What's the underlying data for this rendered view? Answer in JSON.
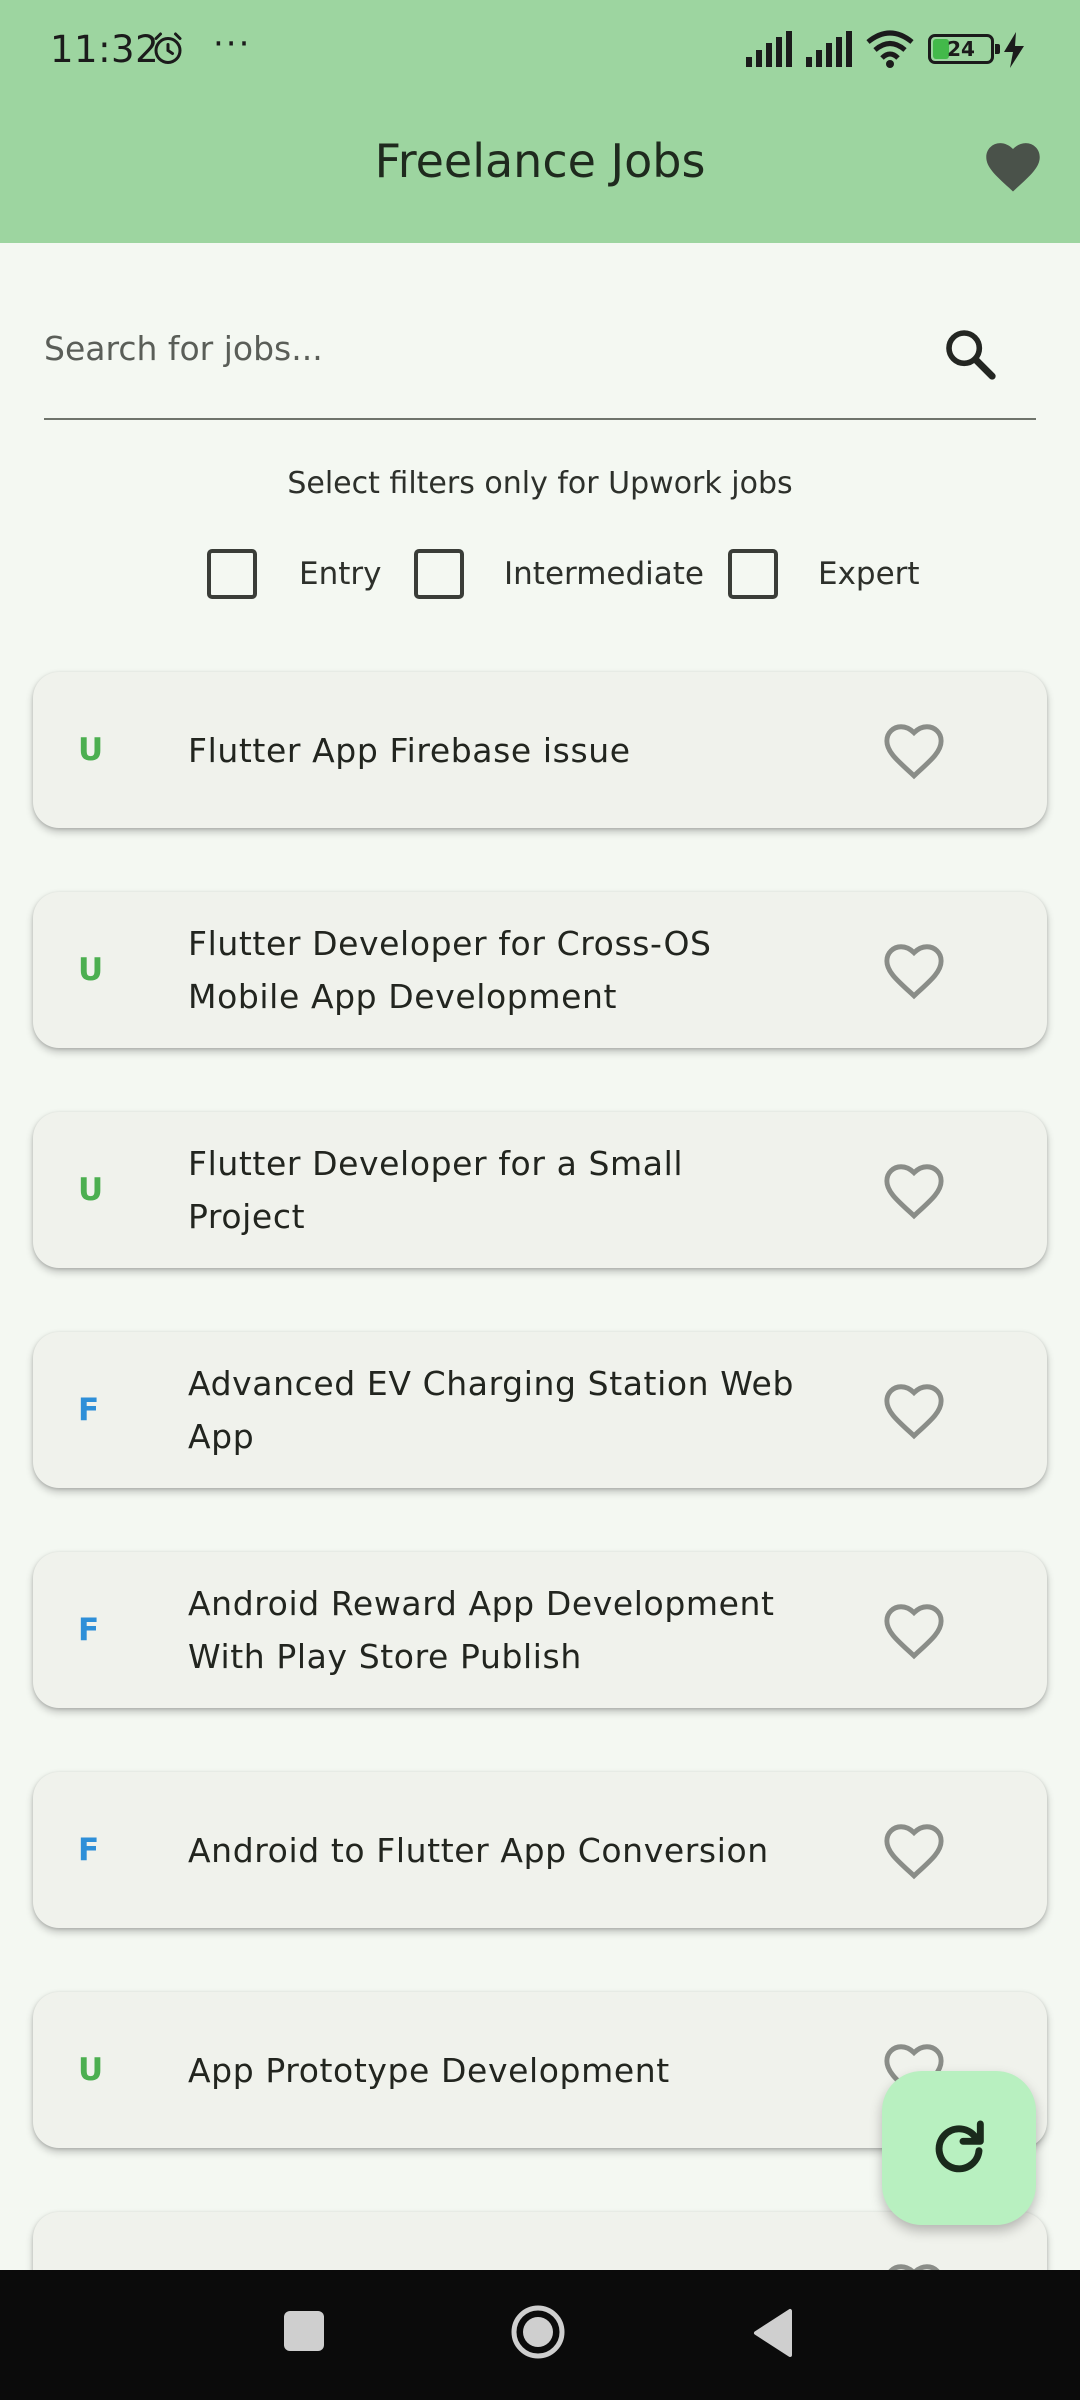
{
  "status_bar": {
    "time": "11:32",
    "more": "···",
    "battery_level": "24",
    "icons": [
      "alarm-icon",
      "signal-icon",
      "signal-icon",
      "wifi-icon",
      "battery-icon",
      "charging-bolt-icon"
    ]
  },
  "app_bar": {
    "title": "Freelance Jobs",
    "favorites_icon": "heart-filled-icon"
  },
  "search": {
    "placeholder": "Search for jobs...",
    "value": "",
    "icon": "search-icon"
  },
  "filters": {
    "caption": "Select filters only for Upwork jobs",
    "options": [
      {
        "label": "Entry",
        "checked": false
      },
      {
        "label": "Intermediate",
        "checked": false
      },
      {
        "label": "Expert",
        "checked": false
      }
    ]
  },
  "jobs": [
    {
      "source": "U",
      "title": "Flutter App Firebase issue",
      "favorite": false
    },
    {
      "source": "U",
      "title": "Flutter Developer for Cross-OS Mobile App Development",
      "favorite": false
    },
    {
      "source": "U",
      "title": "Flutter Developer for a Small Project",
      "favorite": false
    },
    {
      "source": "F",
      "title": "Advanced EV Charging Station Web App",
      "favorite": false
    },
    {
      "source": "F",
      "title": "Android Reward App Development With Play Store Publish",
      "favorite": false
    },
    {
      "source": "F",
      "title": "Android to Flutter App Conversion",
      "favorite": false
    },
    {
      "source": "U",
      "title": "App Prototype Development",
      "favorite": false
    },
    {
      "source": "",
      "title": "",
      "favorite": false
    }
  ],
  "colors": {
    "app_bar": "#9dd5a0",
    "background": "#f4f8f2",
    "upwork_source": "#4caf50",
    "freelancer_source": "#2e8fd8",
    "fab": "#b8f0c0"
  },
  "fab": {
    "icon": "refresh-icon"
  },
  "nav_bar": {
    "icons": [
      "recents-square-icon",
      "home-circle-icon",
      "back-triangle-icon"
    ]
  }
}
